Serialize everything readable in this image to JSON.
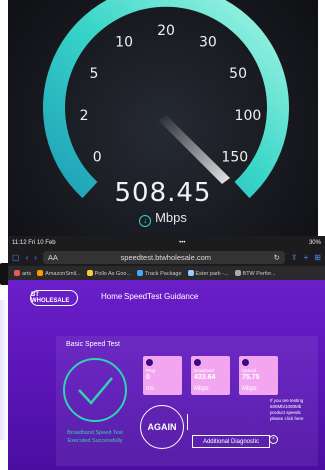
{
  "speedometer": {
    "ticks": [
      "0",
      "2",
      "5",
      "10",
      "20",
      "30",
      "50",
      "100",
      "150"
    ],
    "speed": "508.45",
    "unit": "Mbps",
    "accent": "#35d8c6"
  },
  "browser": {
    "status_time": "11:12",
    "status_date": "Fri 10 Feb",
    "status_dots": "•••",
    "battery": "30%",
    "tab_label": "AA",
    "url": "speedtest.btwholesale.com",
    "bookmarks": [
      "arts",
      "AmazonSmil...",
      "Pollo As Goo...",
      "Track Package",
      "Ester park -...",
      "BTW Perfor..."
    ]
  },
  "site": {
    "logo": "BT WHOLESALE",
    "nav_home": "Home",
    "nav_guidance": "SpeedTest Guidance",
    "panel_title": "Basic Speed Test",
    "status_text": "Broadband Speed Test Executed Successfully",
    "cards": [
      {
        "label": "Ping",
        "value": "0",
        "unit": "ms"
      },
      {
        "label": "Download",
        "value": "433.64",
        "unit": "Mbps"
      },
      {
        "label": "Upload",
        "value": "75.75",
        "unit": "Mbps"
      }
    ],
    "again_label": "AGAIN",
    "diagnostic_label": "Additional Diagnostic",
    "info_text": "If you are testing 500Mb/1000Mb product speeds please click here",
    "close_symbol": "×",
    "bg_color": "#5a14b6",
    "card_color": "#f3a6f0"
  }
}
